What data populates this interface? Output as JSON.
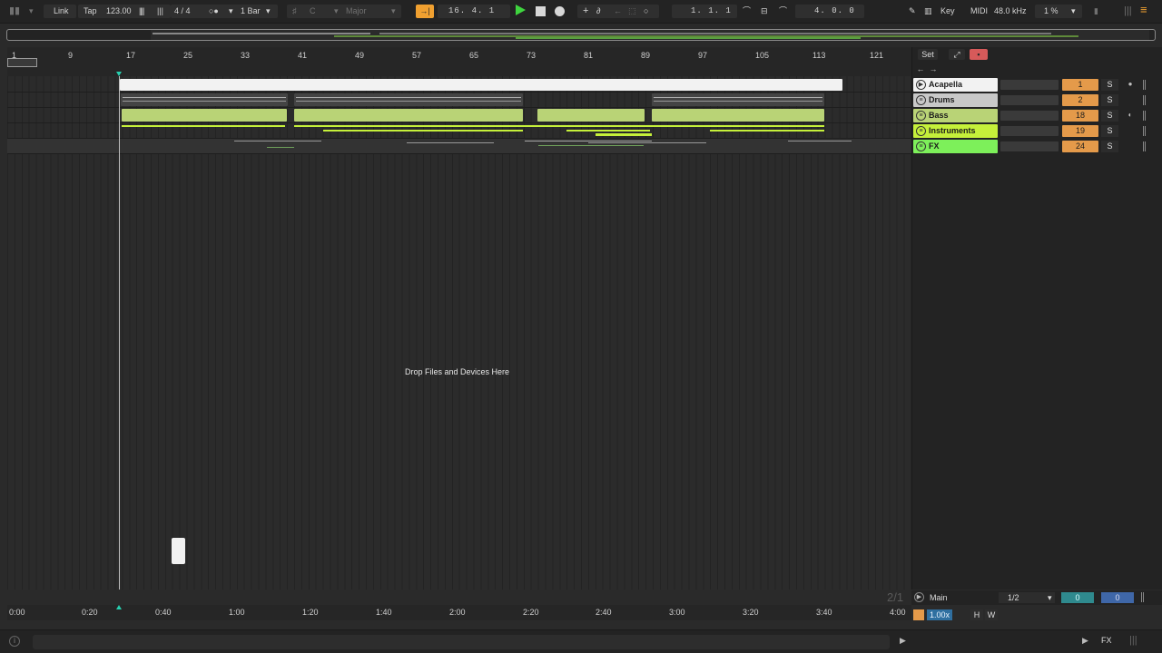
{
  "toolbar": {
    "link_label": "Link",
    "tap_label": "Tap",
    "tempo": "123.00",
    "meter_glyph": "||||",
    "time_signature": "4 / 4",
    "metronome_glyph": "○●",
    "quantize": "1 Bar",
    "key": "C",
    "scale": "Major",
    "arrangement_position": "16.   4.   1",
    "loop_start": "1.   1.   1",
    "loop_length": "4.   0.   0",
    "key_map_label": "Key",
    "midi_map_label": "MIDI",
    "sample_rate": "48.0 kHz",
    "cpu_load": "1 %"
  },
  "ruler": {
    "bars": [
      "1",
      "9",
      "17",
      "25",
      "33",
      "41",
      "49",
      "57",
      "65",
      "73",
      "81",
      "89",
      "97",
      "105",
      "113",
      "121"
    ]
  },
  "arrangement": {
    "drop_hint": "Drop Files and Devices Here"
  },
  "mixer": {
    "set_label": "Set",
    "tracks": [
      {
        "name": "Acapella",
        "number": "1",
        "solo": "S",
        "color": "#f2f2f2"
      },
      {
        "name": "Drums",
        "number": "2",
        "solo": "S",
        "color": "#c8c8c8"
      },
      {
        "name": "Bass",
        "number": "18",
        "solo": "S",
        "color": "#b9d376"
      },
      {
        "name": "Instruments",
        "number": "19",
        "solo": "S",
        "color": "#c5f03a"
      },
      {
        "name": "FX",
        "number": "24",
        "solo": "S",
        "color": "#7df05a"
      }
    ],
    "main": {
      "label": "Main",
      "page_indicator": "2/1",
      "routing": "1/2",
      "value_a": "0",
      "value_b": "0",
      "zoom": "1.00x",
      "h_label": "H",
      "w_label": "W"
    }
  },
  "timeline": {
    "times": [
      "0:00",
      "0:20",
      "0:40",
      "1:00",
      "1:20",
      "1:40",
      "2:00",
      "2:20",
      "2:40",
      "3:00",
      "3:20",
      "3:40",
      "4:00"
    ]
  },
  "status": {
    "fx_label": "FX"
  },
  "colors": {
    "accent_orange": "#f0a030",
    "track_number": "#e49a4a",
    "play_green": "#3fd53f",
    "bass_clip": "#b9d376",
    "instruments_clip": "#c5f03a"
  }
}
